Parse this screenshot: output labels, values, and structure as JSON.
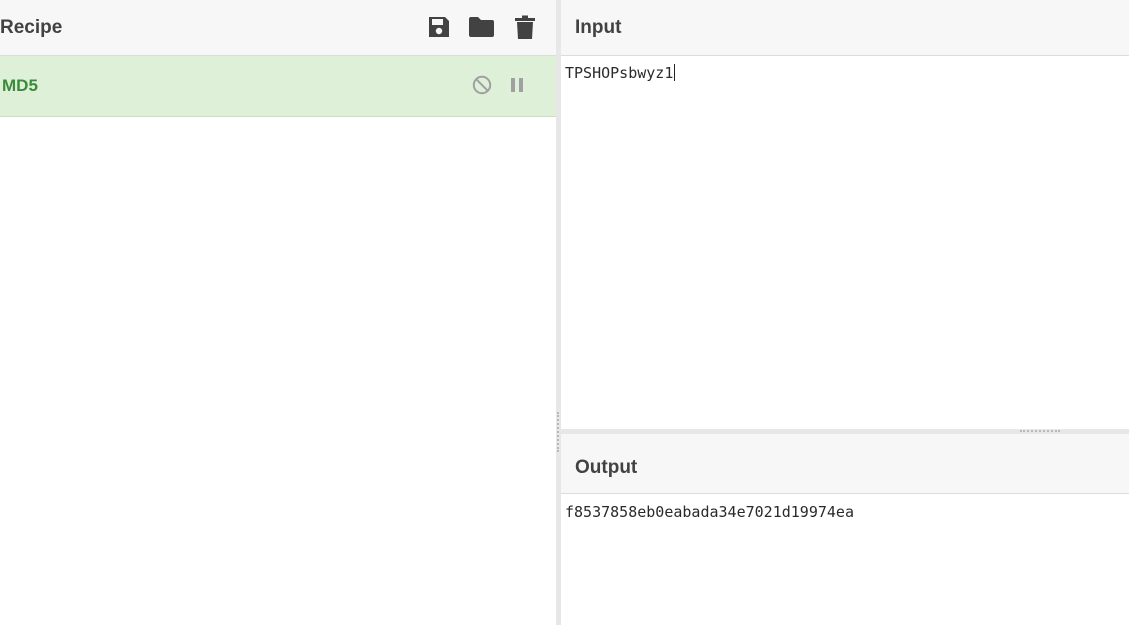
{
  "recipe": {
    "title": "Recipe",
    "icons": [
      "save-icon",
      "folder-icon",
      "trash-icon"
    ],
    "operations": [
      {
        "name": "MD5",
        "controls": [
          "disable-icon",
          "pause-icon"
        ]
      }
    ]
  },
  "input": {
    "title": "Input",
    "value": "TPSHOPsbwyz1"
  },
  "output": {
    "title": "Output",
    "value": "f8537858eb0eabada34e7021d19974ea"
  },
  "colors": {
    "header_bg": "#f7f7f7",
    "operation_bg": "#dff0d8",
    "operation_text": "#3c8b3c",
    "icon": "#424242"
  }
}
